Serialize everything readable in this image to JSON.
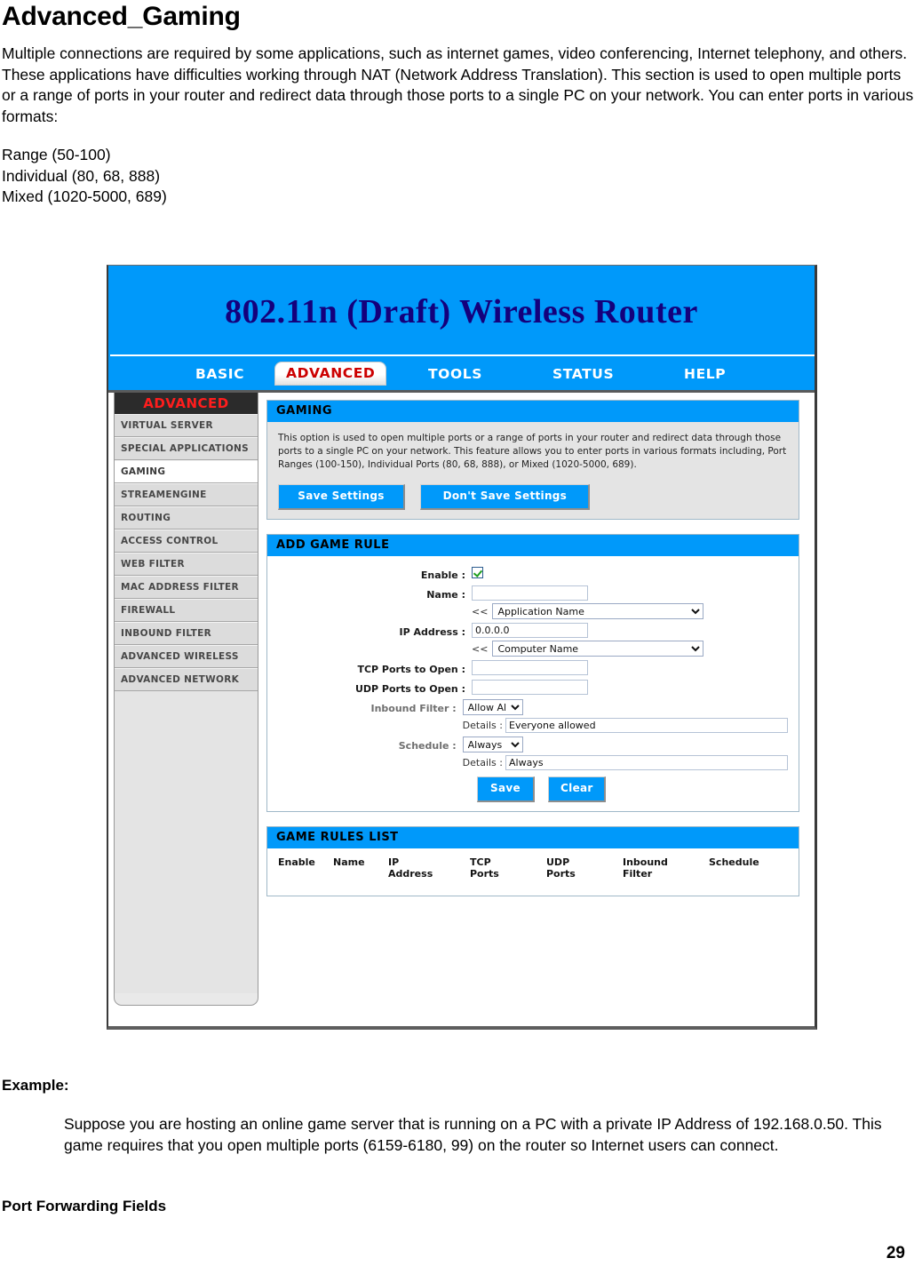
{
  "document": {
    "title": "Advanced_Gaming",
    "intro": "Multiple connections are required by some applications, such as internet games, video conferencing, Internet telephony, and others. These applications have difficulties working through NAT (Network Address Translation). This section is used to open multiple ports or a range of ports in your router and redirect data through those ports to a single PC on your network. You can enter ports in various formats:",
    "format_range": "Range (50-100)",
    "format_individual": "Individual (80, 68, 888)",
    "format_mixed": "Mixed (1020-5000, 689)",
    "example_heading": "Example:",
    "example_body": "Suppose you are hosting an online game server that is running on a PC with a private IP Address of 192.168.0.50. This game requires that you open multiple ports (6159-6180, 99) on the router so Internet users can connect.",
    "port_forwarding_heading": "Port Forwarding Fields",
    "page_number": "29"
  },
  "router": {
    "brand": "802.11n (Draft) Wireless Router",
    "nav": [
      {
        "label": "BASIC",
        "active": false
      },
      {
        "label": "ADVANCED",
        "active": true
      },
      {
        "label": "TOOLS",
        "active": false
      },
      {
        "label": "STATUS",
        "active": false
      },
      {
        "label": "HELP",
        "active": false
      }
    ],
    "sidebar": {
      "title": "ADVANCED",
      "items": [
        {
          "label": "VIRTUAL SERVER",
          "selected": false
        },
        {
          "label": "SPECIAL APPLICATIONS",
          "selected": false
        },
        {
          "label": "GAMING",
          "selected": true
        },
        {
          "label": "STREAMENGINE",
          "selected": false
        },
        {
          "label": "ROUTING",
          "selected": false
        },
        {
          "label": "ACCESS CONTROL",
          "selected": false
        },
        {
          "label": "WEB FILTER",
          "selected": false
        },
        {
          "label": "MAC ADDRESS FILTER",
          "selected": false
        },
        {
          "label": "FIREWALL",
          "selected": false
        },
        {
          "label": "INBOUND FILTER",
          "selected": false
        },
        {
          "label": "ADVANCED WIRELESS",
          "selected": false
        },
        {
          "label": "ADVANCED NETWORK",
          "selected": false
        }
      ]
    },
    "gaming_panel": {
      "heading": "GAMING",
      "description": "This option is used to open multiple ports or a range of ports in your router and redirect data through those ports to a single PC on your network. This feature allows you to enter ports in various formats including, Port Ranges (100-150), Individual Ports (80, 68, 888), or Mixed (1020-5000, 689).",
      "save_settings_label": "Save Settings",
      "dont_save_settings_label": "Don't Save Settings"
    },
    "add_game_rule": {
      "heading": "ADD GAME RULE",
      "enable_label": "Enable :",
      "enable_checked": true,
      "name_label": "Name :",
      "name_value": "",
      "app_arrow": "<<",
      "app_name_selected": "Application Name",
      "ip_label": "IP Address :",
      "ip_value": "0.0.0.0",
      "computer_arrow": "<<",
      "computer_name_selected": "Computer Name",
      "tcp_label": "TCP Ports to Open :",
      "tcp_value": "",
      "udp_label": "UDP Ports to Open :",
      "udp_value": "",
      "inbound_filter_label": "Inbound Filter :",
      "inbound_filter_selected": "Allow All",
      "inbound_details_label": "Details :",
      "inbound_details_value": "Everyone allowed",
      "schedule_label": "Schedule :",
      "schedule_selected": "Always",
      "schedule_details_label": "Details :",
      "schedule_details_value": "Always",
      "save_label": "Save",
      "clear_label": "Clear"
    },
    "game_rules_list": {
      "heading": "GAME RULES LIST",
      "columns": [
        "Enable",
        "Name",
        "IP\nAddress",
        "TCP\nPorts",
        "UDP\nPorts",
        "Inbound\nFilter",
        "Schedule"
      ],
      "col_enable": "Enable",
      "col_name": "Name",
      "col_ip_1": "IP",
      "col_ip_2": "Address",
      "col_tcp_1": "TCP",
      "col_tcp_2": "Ports",
      "col_udp_1": "UDP",
      "col_udp_2": "Ports",
      "col_inbound_1": "Inbound",
      "col_inbound_2": "Filter",
      "col_schedule": "Schedule",
      "rows": []
    }
  },
  "colors": {
    "header_blue": "#0099fa",
    "brand_navy": "#14007c",
    "active_tab_red": "#cc0000",
    "sidebar_title_bg": "#2b2b2b",
    "sidebar_title_text": "#ff1d1d"
  }
}
